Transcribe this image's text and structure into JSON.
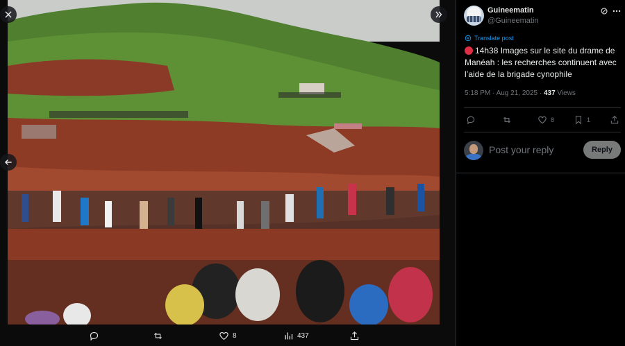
{
  "media_actions": {
    "reply_count": "",
    "repost_count": "",
    "like_count": "8",
    "views_count": "437"
  },
  "post": {
    "author": {
      "display_name": "Guineematin",
      "handle": "@Guineematin"
    },
    "translate_label": "Translate post",
    "text": "14h38 Images sur le site du drame de Manéah : les recherches continuent avec l’aide de la brigade cynophile",
    "time": "5:18 PM · Aug 21, 2025 · ",
    "views_count": "437",
    "views_label": " Views",
    "actions": {
      "like_count": "8",
      "bookmark_count": "1"
    }
  },
  "reply_box": {
    "placeholder": "Post your reply",
    "button_label": "Reply"
  },
  "colors": {
    "accent": "#1d9bf0",
    "background": "#000000",
    "muted": "#71767b",
    "emoji_red": "#dd2e44"
  },
  "icons": [
    "close-icon",
    "prev-arrow-icon",
    "expand-icon",
    "reply-icon",
    "repost-icon",
    "like-icon",
    "views-icon",
    "share-icon",
    "bookmark-icon",
    "grok-icon",
    "more-icon",
    "translate-icon"
  ]
}
